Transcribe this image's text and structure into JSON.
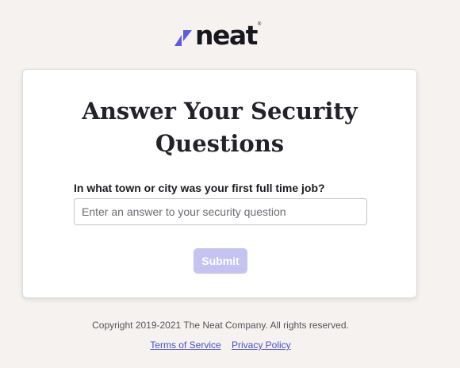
{
  "brand": {
    "name": "neat",
    "registered_mark": "®",
    "mark_color": "#5b5ce0"
  },
  "form": {
    "title": "Answer Your Security Questions",
    "question": "In what town or city was your first full time job?",
    "answer_value": "",
    "answer_placeholder": "Enter an answer to your security question",
    "submit_label": "Submit",
    "submit_enabled": false
  },
  "footer": {
    "copyright": "Copyright 2019-2021 The Neat Company. All rights reserved.",
    "terms_label": "Terms of Service",
    "privacy_label": "Privacy Policy"
  }
}
